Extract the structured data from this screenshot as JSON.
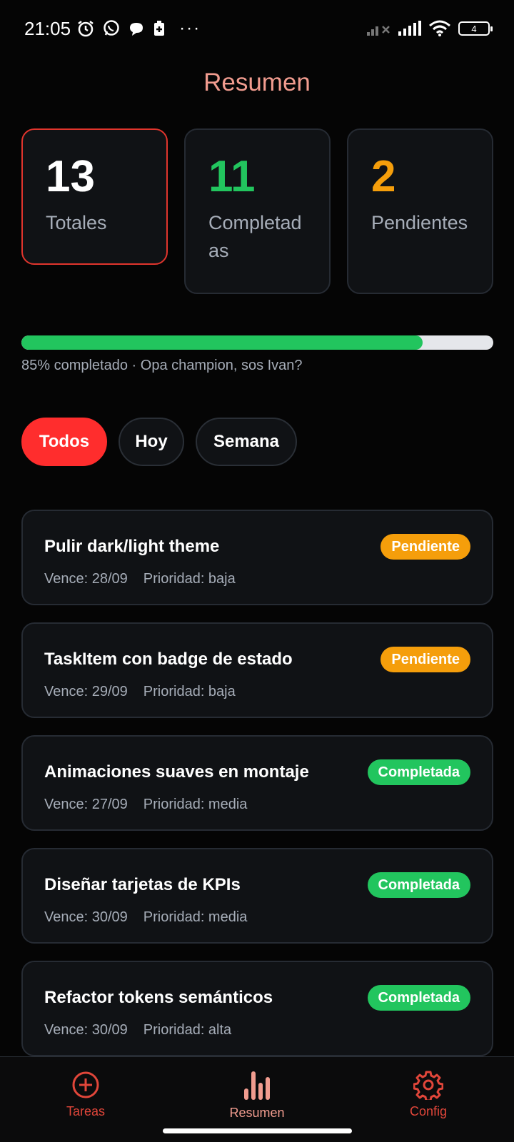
{
  "status_bar": {
    "time": "21:05",
    "left_icons": [
      "alarm-icon",
      "whatsapp-icon",
      "chat-bubble-icon",
      "battery-saver-icon"
    ],
    "more": "···",
    "battery_level": "4"
  },
  "header": {
    "title": "Resumen"
  },
  "kpis": [
    {
      "value": "13",
      "label": "Totales",
      "color": "#ffffff"
    },
    {
      "value": "11",
      "label": "Completadas",
      "color": "#22c55e"
    },
    {
      "value": "2",
      "label": "Pendientes",
      "color": "#f59e0b"
    }
  ],
  "progress": {
    "percent": 85,
    "text": "85% completado · Opa champion, sos Ivan?"
  },
  "filters": [
    {
      "label": "Todos",
      "active": true
    },
    {
      "label": "Hoy",
      "active": false
    },
    {
      "label": "Semana",
      "active": false
    }
  ],
  "tasks": [
    {
      "title": "Pulir dark/light theme",
      "due": "Vence: 28/09",
      "priority": "Prioridad: baja",
      "status": "Pendiente"
    },
    {
      "title": "TaskItem con badge de estado",
      "due": "Vence: 29/09",
      "priority": "Prioridad: baja",
      "status": "Pendiente"
    },
    {
      "title": "Animaciones suaves en montaje",
      "due": "Vence: 27/09",
      "priority": "Prioridad: media",
      "status": "Completada"
    },
    {
      "title": "Diseñar tarjetas de KPIs",
      "due": "Vence: 30/09",
      "priority": "Prioridad: media",
      "status": "Completada"
    },
    {
      "title": "Refactor tokens semánticos",
      "due": "Vence: 30/09",
      "priority": "Prioridad: alta",
      "status": "Completada"
    }
  ],
  "bottom_nav": [
    {
      "label": "Tareas",
      "icon": "plus-circle-icon"
    },
    {
      "label": "Resumen",
      "icon": "bar-chart-icon",
      "active": true
    },
    {
      "label": "Config",
      "icon": "gear-icon"
    }
  ],
  "colors": {
    "accent": "#ff2d2d",
    "title": "#f19c8f",
    "success": "#22c55e",
    "warning": "#f59e0b"
  }
}
